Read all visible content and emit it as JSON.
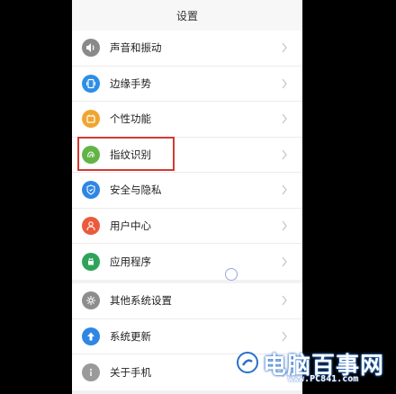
{
  "header": {
    "title": "设置"
  },
  "group1": [
    {
      "label": "声音和振动",
      "icon": "speaker-icon",
      "color": "#8a8a8a"
    },
    {
      "label": "边缘手势",
      "icon": "edge-gesture-icon",
      "color": "#2e8ee6"
    },
    {
      "label": "个性功能",
      "icon": "personal-features-icon",
      "color": "#f0a531"
    },
    {
      "label": "指纹识别",
      "icon": "fingerprint-icon",
      "color": "#62b446"
    },
    {
      "label": "安全与隐私",
      "icon": "shield-icon",
      "color": "#2f86e4"
    },
    {
      "label": "用户中心",
      "icon": "user-icon",
      "color": "#ea5a3c"
    },
    {
      "label": "应用程序",
      "icon": "app-icon",
      "color": "#2fa35a"
    }
  ],
  "group2": [
    {
      "label": "其他系统设置",
      "icon": "gear-icon",
      "color": "#8d8d8d"
    },
    {
      "label": "系统更新",
      "icon": "update-arrow-icon",
      "color": "#2f86e4"
    },
    {
      "label": "关于手机",
      "icon": "info-icon",
      "color": "#9a9a9a"
    }
  ],
  "watermark": {
    "brand": "电脑百事网",
    "url": "www.PC841.com"
  }
}
